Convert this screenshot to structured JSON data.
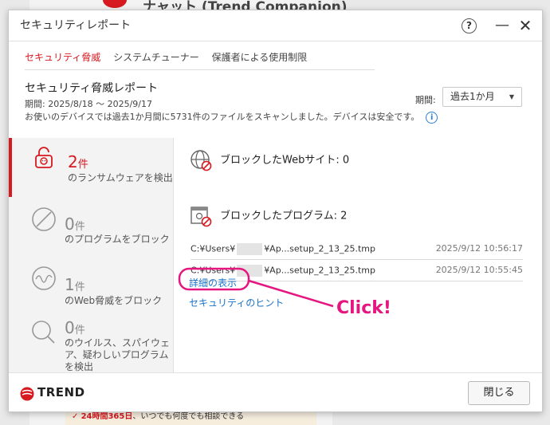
{
  "background": {
    "title": "ナャット (Trend Companion)",
    "banner_highlight": "24時間365日",
    "banner_text": "、いつでも何度でも相談できる"
  },
  "window": {
    "title": "セキュリティレポート",
    "help_label": "?",
    "minimize_label": "—",
    "close_label": "✕"
  },
  "tabs": [
    {
      "label": "セキュリティ脅威",
      "active": true
    },
    {
      "label": "システムチューナー",
      "active": false
    },
    {
      "label": "保護者による使用制限",
      "active": false
    }
  ],
  "report": {
    "title": "セキュリティ脅威レポート",
    "period": "期間: 2025/8/18 〜 2025/9/17",
    "summary": "お使いのデバイスでは過去1か月間に5731件のファイルをスキャンしました。デバイスは安全です。"
  },
  "period_filter": {
    "label": "期間:",
    "selected": "過去1か月"
  },
  "stats": [
    {
      "count": "2",
      "unit": "件",
      "label": "のランサムウェアを検出",
      "icon": "ransomware-lock-icon",
      "active": true
    },
    {
      "count": "0",
      "unit": "件",
      "label": "のプログラムをブロック",
      "icon": "blocked-program-icon",
      "active": false
    },
    {
      "count": "1",
      "unit": "件",
      "label": "のWeb脅威をブロック",
      "icon": "web-threat-icon",
      "active": false
    },
    {
      "count": "0",
      "unit": "件",
      "label": "のウイルス、スパイウェア、疑わしいプログラムを検出",
      "icon": "virus-scan-icon",
      "active": false
    }
  ],
  "blocked_websites": {
    "label": "ブロックしたWebサイト: 0"
  },
  "blocked_programs": {
    "label": "ブロックしたプログラム: 2",
    "items": [
      {
        "path_prefix": "C:¥Users¥",
        "path_suffix": "¥Ap...setup_2_13_25.tmp",
        "time": "2025/9/12 10:56:17"
      },
      {
        "path_prefix": "C:¥Users¥",
        "path_suffix": "¥Ap...setup_2_13_25.tmp",
        "time": "2025/9/12 10:55:45"
      }
    ]
  },
  "links": {
    "details": "詳細の表示",
    "hints": "セキュリティのヒント"
  },
  "footer": {
    "brand": "TREND",
    "close_button": "閉じる"
  },
  "annotation": {
    "label": "Click!",
    "color": "#e5167f"
  },
  "colors": {
    "accent": "#d71920",
    "link": "#1a73c7"
  }
}
